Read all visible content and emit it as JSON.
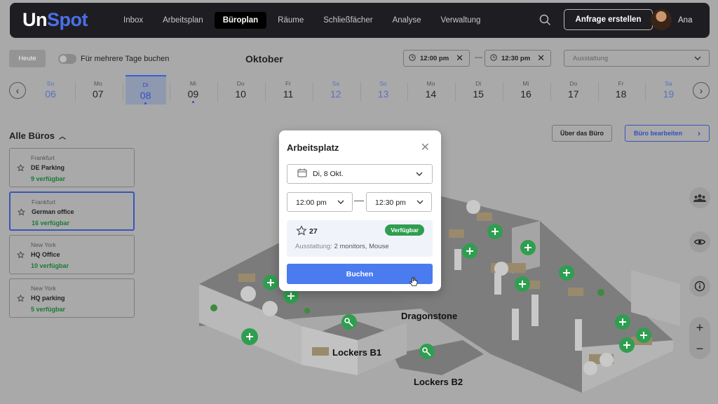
{
  "app": {
    "logo_part1": "Un",
    "logo_part2": "Spot",
    "nav": [
      "Inbox",
      "Arbeitsplan",
      "Büroplan",
      "Räume",
      "Schließfächer",
      "Analyse",
      "Verwaltung"
    ],
    "active_nav": "Büroplan",
    "request_button": "Anfrage erstellen",
    "user_name": "Ana"
  },
  "toolbar": {
    "today": "Heute",
    "multi_day": "Für mehrere Tage buchen",
    "month": "Oktober",
    "start_time": "12:00 pm",
    "end_time": "12:30 pm",
    "time_separator": "—",
    "equipment_placeholder": "Ausstattung"
  },
  "calendar": {
    "days": [
      {
        "w": "So",
        "n": "06",
        "weekend": true
      },
      {
        "w": "Mo",
        "n": "07"
      },
      {
        "w": "Di",
        "n": "08",
        "selected": true,
        "dot": true
      },
      {
        "w": "Mi",
        "n": "09",
        "dot": true
      },
      {
        "w": "Do",
        "n": "10"
      },
      {
        "w": "Fr",
        "n": "11"
      },
      {
        "w": "Sa",
        "n": "12",
        "weekend": true
      },
      {
        "w": "So",
        "n": "13",
        "weekend": true
      },
      {
        "w": "Mo",
        "n": "14"
      },
      {
        "w": "Di",
        "n": "15"
      },
      {
        "w": "Mi",
        "n": "16"
      },
      {
        "w": "Do",
        "n": "17"
      },
      {
        "w": "Fr",
        "n": "18"
      },
      {
        "w": "Sa",
        "n": "19",
        "weekend": true
      }
    ]
  },
  "offices": {
    "heading": "Alle Büros",
    "items": [
      {
        "city": "Frankfurt",
        "name": "DE Parking",
        "available": "9 verfügbar"
      },
      {
        "city": "Frankfurt",
        "name": "German office",
        "available": "16 verfügbar",
        "selected": true
      },
      {
        "city": "New York",
        "name": "HQ Office",
        "available": "10 verfügbar"
      },
      {
        "city": "New York",
        "name": "HQ parking",
        "available": "5 verfügbar"
      }
    ]
  },
  "office_actions": {
    "about": "Über das Büro",
    "edit": "Büro bearbeiten"
  },
  "map": {
    "labels": [
      "Dragonstone",
      "Lockers B1",
      "Lockers B2"
    ]
  },
  "modal": {
    "title": "Arbeitsplatz",
    "date": "Di, 8 Okt.",
    "start": "12:00 pm",
    "end": "12:30 pm",
    "desk_number": "27",
    "status": "Verfügbar",
    "equipment_label": "Ausstattung:",
    "equipment_value": "2 monitors, Mouse",
    "book": "Buchen"
  },
  "colors": {
    "accent": "#4a7cf0",
    "available": "#2f9e50",
    "topbar": "#1e1e22",
    "overlay": "#a9a9a9"
  }
}
